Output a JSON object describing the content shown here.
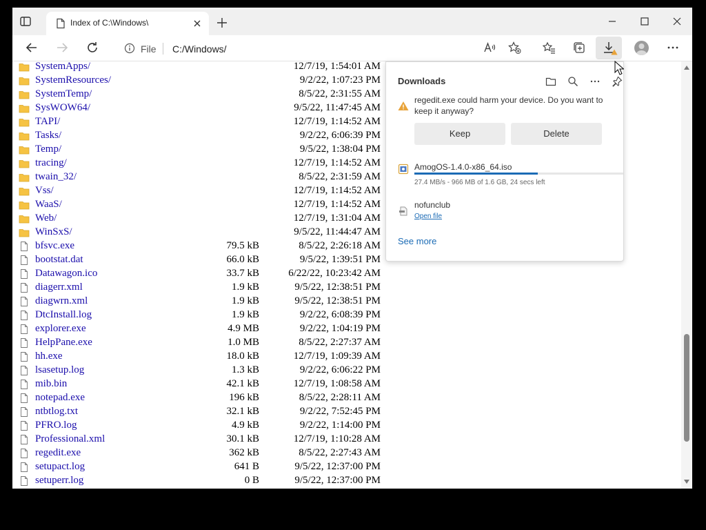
{
  "tab": {
    "title": "Index of C:\\Windows\\"
  },
  "address": {
    "scheme": "File",
    "url": "C:/Windows/"
  },
  "colors": {
    "link": "#1a0dab",
    "accent": "#1b6bb5",
    "warning": "#e8a33a",
    "folder": "#f6c343"
  },
  "listing": [
    {
      "kind": "folder",
      "name": "SystemApps/",
      "size": "",
      "date": "12/7/19, 1:54:01 AM"
    },
    {
      "kind": "folder",
      "name": "SystemResources/",
      "size": "",
      "date": "9/2/22, 1:07:23 PM"
    },
    {
      "kind": "folder",
      "name": "SystemTemp/",
      "size": "",
      "date": "8/5/22, 2:31:55 AM"
    },
    {
      "kind": "folder",
      "name": "SysWOW64/",
      "size": "",
      "date": "9/5/22, 11:47:45 AM"
    },
    {
      "kind": "folder",
      "name": "TAPI/",
      "size": "",
      "date": "12/7/19, 1:14:52 AM"
    },
    {
      "kind": "folder",
      "name": "Tasks/",
      "size": "",
      "date": "9/2/22, 6:06:39 PM"
    },
    {
      "kind": "folder",
      "name": "Temp/",
      "size": "",
      "date": "9/5/22, 1:38:04 PM"
    },
    {
      "kind": "folder",
      "name": "tracing/",
      "size": "",
      "date": "12/7/19, 1:14:52 AM"
    },
    {
      "kind": "folder",
      "name": "twain_32/",
      "size": "",
      "date": "8/5/22, 2:31:59 AM"
    },
    {
      "kind": "folder",
      "name": "Vss/",
      "size": "",
      "date": "12/7/19, 1:14:52 AM"
    },
    {
      "kind": "folder",
      "name": "WaaS/",
      "size": "",
      "date": "12/7/19, 1:14:52 AM"
    },
    {
      "kind": "folder",
      "name": "Web/",
      "size": "",
      "date": "12/7/19, 1:31:04 AM"
    },
    {
      "kind": "folder",
      "name": "WinSxS/",
      "size": "",
      "date": "9/5/22, 11:44:47 AM"
    },
    {
      "kind": "file",
      "name": "bfsvc.exe",
      "size": "79.5 kB",
      "date": "8/5/22, 2:26:18 AM"
    },
    {
      "kind": "file",
      "name": "bootstat.dat",
      "size": "66.0 kB",
      "date": "9/5/22, 1:39:51 PM"
    },
    {
      "kind": "file",
      "name": "Datawagon.ico",
      "size": "33.7 kB",
      "date": "6/22/22, 10:23:42 AM"
    },
    {
      "kind": "file",
      "name": "diagerr.xml",
      "size": "1.9 kB",
      "date": "9/5/22, 12:38:51 PM"
    },
    {
      "kind": "file",
      "name": "diagwrn.xml",
      "size": "1.9 kB",
      "date": "9/5/22, 12:38:51 PM"
    },
    {
      "kind": "file",
      "name": "DtcInstall.log",
      "size": "1.9 kB",
      "date": "9/2/22, 6:08:39 PM"
    },
    {
      "kind": "file",
      "name": "explorer.exe",
      "size": "4.9 MB",
      "date": "9/2/22, 1:04:19 PM"
    },
    {
      "kind": "file",
      "name": "HelpPane.exe",
      "size": "1.0 MB",
      "date": "8/5/22, 2:27:37 AM"
    },
    {
      "kind": "file",
      "name": "hh.exe",
      "size": "18.0 kB",
      "date": "12/7/19, 1:09:39 AM"
    },
    {
      "kind": "file",
      "name": "lsasetup.log",
      "size": "1.3 kB",
      "date": "9/2/22, 6:06:22 PM"
    },
    {
      "kind": "file",
      "name": "mib.bin",
      "size": "42.1 kB",
      "date": "12/7/19, 1:08:58 AM"
    },
    {
      "kind": "file",
      "name": "notepad.exe",
      "size": "196 kB",
      "date": "8/5/22, 2:28:11 AM"
    },
    {
      "kind": "file",
      "name": "ntbtlog.txt",
      "size": "32.1 kB",
      "date": "9/2/22, 7:52:45 PM"
    },
    {
      "kind": "file",
      "name": "PFRO.log",
      "size": "4.9 kB",
      "date": "9/2/22, 1:14:00 PM"
    },
    {
      "kind": "file",
      "name": "Professional.xml",
      "size": "30.1 kB",
      "date": "12/7/19, 1:10:28 AM"
    },
    {
      "kind": "file",
      "name": "regedit.exe",
      "size": "362 kB",
      "date": "8/5/22, 2:27:43 AM"
    },
    {
      "kind": "file",
      "name": "setupact.log",
      "size": "641 B",
      "date": "9/5/22, 12:37:00 PM"
    },
    {
      "kind": "file",
      "name": "setuperr.log",
      "size": "0 B",
      "date": "9/5/22, 12:37:00 PM"
    }
  ],
  "downloads": {
    "title": "Downloads",
    "warning_text": "regedit.exe could harm your device. Do you want to keep it anyway?",
    "keep_label": "Keep",
    "delete_label": "Delete",
    "items": [
      {
        "name": "AmogOS-1.4.0-x86_64.iso",
        "status": "27.4 MB/s - 966 MB of 1.6 GB, 24 secs left",
        "progress": 0.59
      },
      {
        "name": "nofunclub",
        "action": "Open file"
      }
    ],
    "see_more": "See more"
  }
}
